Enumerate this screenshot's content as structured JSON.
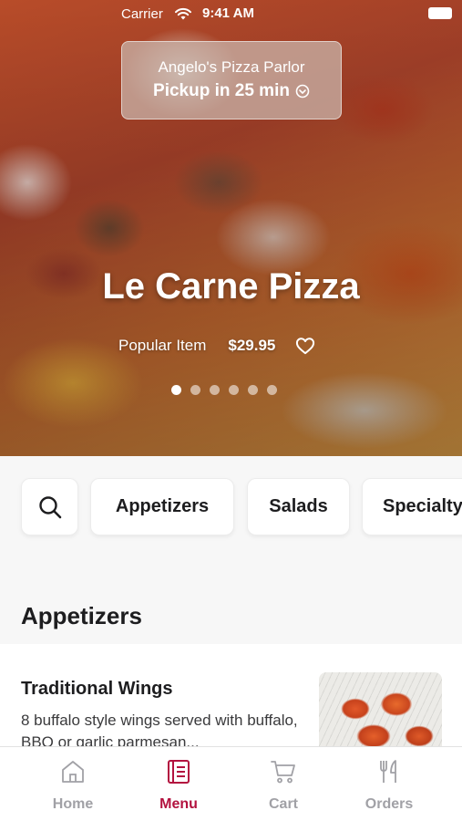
{
  "status_bar": {
    "carrier": "Carrier",
    "time": "9:41 AM"
  },
  "pickup": {
    "restaurant": "Angelo's Pizza Parlor",
    "eta": "Pickup in 25 min"
  },
  "hero": {
    "title": "Le Carne Pizza",
    "tag": "Popular Item",
    "price": "$29.95",
    "carousel": {
      "count": 6,
      "active_index": 0
    }
  },
  "categories": [
    "Appetizers",
    "Salads",
    "Specialty"
  ],
  "section": {
    "title": "Appetizers"
  },
  "menu_item": {
    "name": "Traditional Wings",
    "description": "8 buffalo style wings served with buffalo, BBQ or garlic parmesan..."
  },
  "tabs": [
    {
      "label": "Home",
      "icon": "home-icon"
    },
    {
      "label": "Menu",
      "icon": "menu-icon"
    },
    {
      "label": "Cart",
      "icon": "cart-icon"
    },
    {
      "label": "Orders",
      "icon": "fork-knife-icon"
    }
  ],
  "active_tab": "Menu",
  "colors": {
    "accent": "#b3123f",
    "inactive": "#a1a1a6"
  }
}
